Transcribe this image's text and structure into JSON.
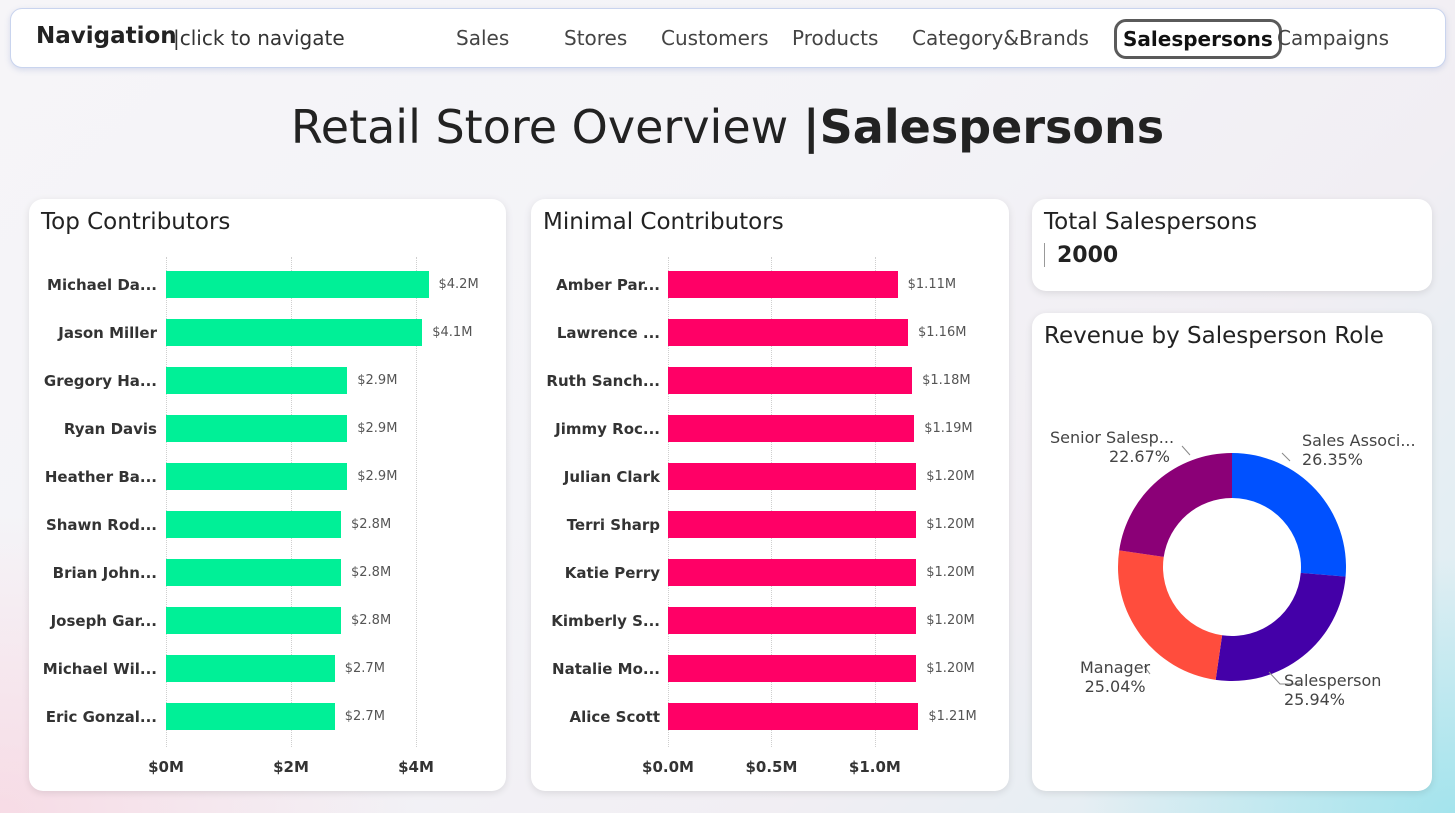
{
  "nav": {
    "title": "Navigation",
    "hint": "|click to navigate",
    "items": [
      "Sales",
      "Stores",
      "Customers",
      "Products",
      "Category&Brands",
      "Salespersons",
      "Campaigns"
    ],
    "active": "Salespersons"
  },
  "page": {
    "title_prefix": "Retail Store Overview ",
    "title_bold": "|Salespersons"
  },
  "top": {
    "title": "Top Contributors",
    "names": [
      "Michael Da...",
      "Jason Miller",
      "Gregory Ha...",
      "Ryan Davis",
      "Heather Ba...",
      "Shawn Rod...",
      "Brian John...",
      "Joseph Gar...",
      "Michael Wil...",
      "Eric Gonzal..."
    ],
    "value_labels": [
      "$4.2M",
      "$4.1M",
      "$2.9M",
      "$2.9M",
      "$2.9M",
      "$2.8M",
      "$2.8M",
      "$2.8M",
      "$2.7M",
      "$2.7M"
    ],
    "ticks": [
      "$0M",
      "$2M",
      "$4M"
    ],
    "color": "#00f097"
  },
  "minimal": {
    "title": "Minimal Contributors",
    "names": [
      "Amber Par...",
      "Lawrence ...",
      "Ruth Sanch...",
      "Jimmy Roc...",
      "Julian Clark",
      "Terri Sharp",
      "Katie Perry",
      "Kimberly S...",
      "Natalie Mo...",
      "Alice Scott"
    ],
    "value_labels": [
      "$1.11M",
      "$1.16M",
      "$1.18M",
      "$1.19M",
      "$1.20M",
      "$1.20M",
      "$1.20M",
      "$1.20M",
      "$1.20M",
      "$1.21M"
    ],
    "ticks": [
      "$0.0M",
      "$0.5M",
      "$1.0M"
    ],
    "color": "#ff0066"
  },
  "kpi": {
    "title": "Total Salespersons",
    "value": "2000"
  },
  "donut": {
    "title": "Revenue by Salesperson Role",
    "labels": [
      {
        "name": "Sales Associ...",
        "pct": "26.35%"
      },
      {
        "name": "Salesperson",
        "pct": "25.94%"
      },
      {
        "name": "Manager",
        "pct": "25.04%"
      },
      {
        "name": "Senior Salesp...",
        "pct": "22.67%"
      }
    ]
  },
  "chart_data": [
    {
      "type": "bar",
      "orientation": "horizontal",
      "title": "Top Contributors",
      "categories": [
        "Michael Da...",
        "Jason Miller",
        "Gregory Ha...",
        "Ryan Davis",
        "Heather Ba...",
        "Shawn Rod...",
        "Brian John...",
        "Joseph Gar...",
        "Michael Wil...",
        "Eric Gonzal..."
      ],
      "values": [
        4.2,
        4.1,
        2.9,
        2.9,
        2.9,
        2.8,
        2.8,
        2.8,
        2.7,
        2.7
      ],
      "value_unit": "$M",
      "xlim": [
        0,
        4.8
      ],
      "xticks": [
        0,
        2,
        4
      ],
      "grid": true,
      "color": "#00f097"
    },
    {
      "type": "bar",
      "orientation": "horizontal",
      "title": "Minimal Contributors",
      "categories": [
        "Amber Par...",
        "Lawrence ...",
        "Ruth Sanch...",
        "Jimmy Roc...",
        "Julian Clark",
        "Terri Sharp",
        "Katie Perry",
        "Kimberly S...",
        "Natalie Mo...",
        "Alice Scott"
      ],
      "values": [
        1.11,
        1.16,
        1.18,
        1.19,
        1.2,
        1.2,
        1.2,
        1.2,
        1.2,
        1.21
      ],
      "value_unit": "$M",
      "xlim": [
        0,
        1.45
      ],
      "xticks": [
        0,
        0.5,
        1.0
      ],
      "grid": true,
      "color": "#ff0066"
    },
    {
      "type": "pie",
      "variant": "donut",
      "title": "Revenue by Salesperson Role",
      "categories": [
        "Sales Associ...",
        "Salesperson",
        "Manager",
        "Senior Salesp..."
      ],
      "values": [
        26.35,
        25.94,
        25.04,
        22.67
      ],
      "colors": [
        "#0051ff",
        "#4400a8",
        "#ff4d3d",
        "#8b0077"
      ]
    }
  ]
}
